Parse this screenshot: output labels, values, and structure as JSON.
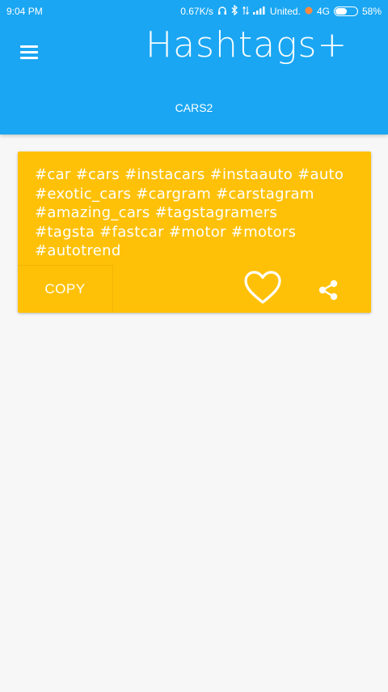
{
  "status_bar": {
    "time": "9:04 PM",
    "network_speed": "0.67K/s",
    "carrier": "United.",
    "network_type": "4G",
    "battery_percent": "58%",
    "battery_level": 0.58
  },
  "header": {
    "title": "Hashtags+",
    "tab_label": "CARS2",
    "background_color": "#1aa6f3"
  },
  "card": {
    "background_color": "#ffc107",
    "hashtag_lines": [
      "#car #cars #instacars #instaauto #auto",
      "#exotic_cars #cargram #carstagram",
      "#amazing_cars #tagstagramers",
      "#tagsta #fastcar #motor #motors",
      "#autotrend"
    ],
    "copy_label": "COPY"
  },
  "icons": {
    "menu": "hamburger-menu-icon",
    "favorite": "heart-outline-icon",
    "share": "share-icon"
  }
}
